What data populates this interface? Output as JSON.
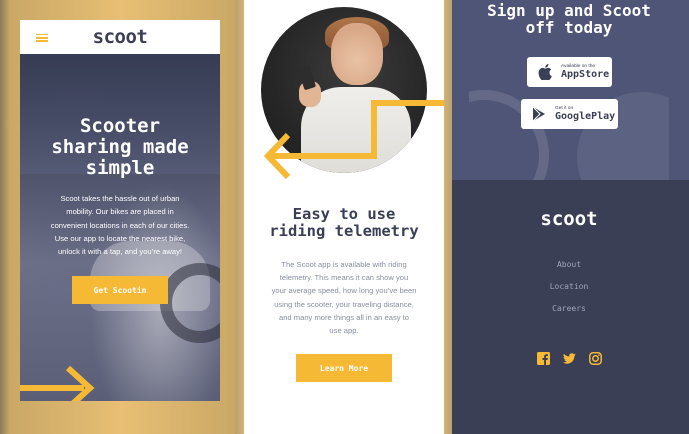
{
  "screen1": {
    "logo": "scoot",
    "hero_title_lines": [
      "Scooter",
      "sharing made",
      "simple"
    ],
    "hero_text_lines": [
      "Scoot takes the hassle out of urban",
      "mobility. Our bikes are placed in",
      "convenient locations in each of our cities.",
      "Use our app to locate the nearest bike,",
      "unlock it with a tap, and you’re away!"
    ],
    "cta_label": "Get Scootin"
  },
  "screen2": {
    "title_lines": [
      "Easy to use",
      "riding telemetry"
    ],
    "text_lines": [
      "The Scoot app is available with riding",
      "telemetry. This means it can show you",
      "your average speed, how long you’ve been",
      "using the scooter, your traveling distance,",
      "and many more things all in an easy to",
      "use app."
    ],
    "cta_label": "Learn More"
  },
  "screen3": {
    "title_lines": [
      "Sign up and Scoot",
      "off today"
    ],
    "apple_badge": {
      "small": "Available on the",
      "big": "AppStore"
    },
    "google_badge": {
      "small": "Get it on",
      "big": "GooglePlay"
    },
    "footer_logo": "scoot",
    "footer_links": [
      "About",
      "Location",
      "Careers"
    ],
    "social_icons": [
      "facebook-icon",
      "twitter-icon",
      "instagram-icon"
    ]
  },
  "colors": {
    "accent": "#f5b935",
    "dark": "#3b3f55",
    "slate": "#4f5577",
    "muted_text": "#8a8ea2"
  }
}
